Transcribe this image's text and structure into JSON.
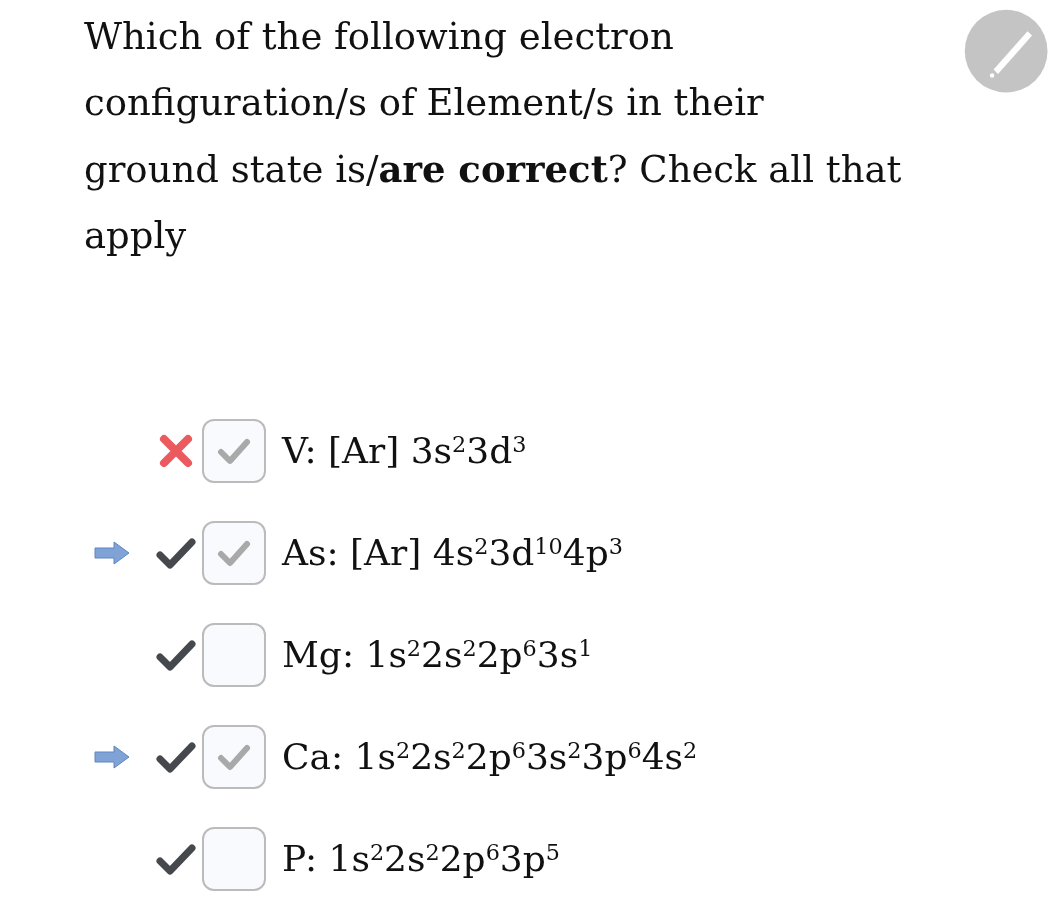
{
  "question": "Which of the following electron configuration/s of Element/s in their ground state is/**are correct**? Check all that apply",
  "options": [
    {
      "text": "V: [Ar] 3s$^{2}$3d$^{3}$",
      "checked": true,
      "correct": false,
      "arrow": false
    },
    {
      "text": "As: [Ar] 4s$^{2}$3d$^{10}$4p$^{3}$",
      "checked": true,
      "correct": true,
      "arrow": true
    },
    {
      "text": "Mg: 1s$^{2}$2s$^{2}$2p$^{6}$3s$^{1}$",
      "checked": false,
      "correct": true,
      "arrow": false
    },
    {
      "text": "Ca: 1s$^{2}$2s$^{2}$2p$^{6}$3s$^{2}$3p$^{6}$4s$^{2}$",
      "checked": true,
      "correct": true,
      "arrow": true
    },
    {
      "text": "P: 1s$^{2}$2s$^{2}$2p$^{6}$3p$^{5}$",
      "checked": false,
      "correct": true,
      "arrow": false
    }
  ]
}
